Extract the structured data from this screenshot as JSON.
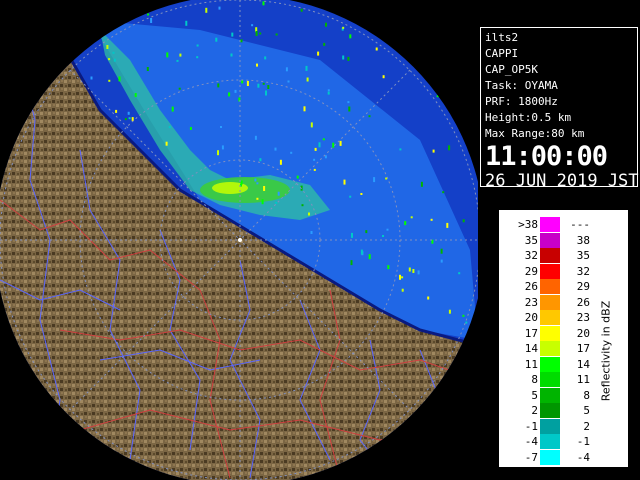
{
  "info": {
    "site": "ilts2",
    "product": "CAPPI",
    "code": "CAP_OP5K",
    "task": "Task: OYAMA",
    "prf": "PRF: 1800Hz",
    "height": "Height:0.5 km",
    "range": "Max Range:80 km",
    "time": "11:00:00",
    "date": "26 JUN 2019 JST"
  },
  "legend": {
    "unit": "Reflectivity in dBZ",
    "rows": [
      {
        "lo": ">38",
        "hi": "---",
        "color": "#ff00ff"
      },
      {
        "lo": "35",
        "hi": "38",
        "color": "#c800c8"
      },
      {
        "lo": "32",
        "hi": "35",
        "color": "#c80000"
      },
      {
        "lo": "29",
        "hi": "32",
        "color": "#ff0000"
      },
      {
        "lo": "26",
        "hi": "29",
        "color": "#ff6400"
      },
      {
        "lo": "23",
        "hi": "26",
        "color": "#ff9600"
      },
      {
        "lo": "20",
        "hi": "23",
        "color": "#ffc800"
      },
      {
        "lo": "17",
        "hi": "20",
        "color": "#ffff00"
      },
      {
        "lo": "14",
        "hi": "17",
        "color": "#c8ff00"
      },
      {
        "lo": "11",
        "hi": "14",
        "color": "#00ff00"
      },
      {
        "lo": "8",
        "hi": "11",
        "color": "#00dc00"
      },
      {
        "lo": "5",
        "hi": "8",
        "color": "#00b400"
      },
      {
        "lo": "2",
        "hi": "5",
        "color": "#009600"
      },
      {
        "lo": "-1",
        "hi": "2",
        "color": "#00a0a0"
      },
      {
        "lo": "-4",
        "hi": "-1",
        "color": "#00c8c8"
      },
      {
        "lo": "-7",
        "hi": "-4",
        "color": "#00ffff"
      }
    ]
  },
  "map": {
    "ocean_color": "#1a3fc0",
    "echo_color": "#1e78ff",
    "land_color": "#7a6440",
    "river_color": "#5a66ff",
    "border_color": "#c83c3c",
    "ring_color": "#ffffff"
  }
}
